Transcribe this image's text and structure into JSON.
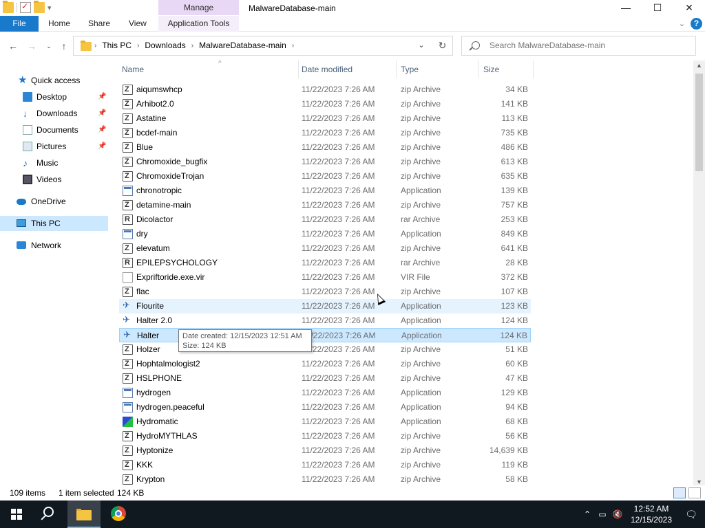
{
  "window": {
    "title": "MalwareDatabase-main",
    "context_tab": "Manage",
    "controls": {
      "minimize": "—",
      "maximize": "☐",
      "close": "✕"
    }
  },
  "ribbon": {
    "tabs": [
      "File",
      "Home",
      "Share",
      "View",
      "Application Tools"
    ]
  },
  "address": {
    "crumbs": [
      "This PC",
      "Downloads",
      "MalwareDatabase-main"
    ],
    "search_placeholder": "Search MalwareDatabase-main"
  },
  "nav": {
    "quick_access": "Quick access",
    "items": [
      {
        "label": "Desktop",
        "icon": "desktop-icon",
        "pinned": true
      },
      {
        "label": "Downloads",
        "icon": "downloads-icon",
        "pinned": true
      },
      {
        "label": "Documents",
        "icon": "documents-icon",
        "pinned": true
      },
      {
        "label": "Pictures",
        "icon": "pictures-icon",
        "pinned": true
      },
      {
        "label": "Music",
        "icon": "music-icon",
        "pinned": false
      },
      {
        "label": "Videos",
        "icon": "videos-icon",
        "pinned": false
      }
    ],
    "onedrive": "OneDrive",
    "thispc": "This PC",
    "network": "Network"
  },
  "columns": {
    "name": "Name",
    "date": "Date modified",
    "type": "Type",
    "size": "Size"
  },
  "files": [
    {
      "name": "aiqumswhcp",
      "date": "11/22/2023 7:26 AM",
      "type": "zip Archive",
      "size": "34 KB",
      "icon": "zip"
    },
    {
      "name": "Arhibot2.0",
      "date": "11/22/2023 7:26 AM",
      "type": "zip Archive",
      "size": "141 KB",
      "icon": "zip"
    },
    {
      "name": "Astatine",
      "date": "11/22/2023 7:26 AM",
      "type": "zip Archive",
      "size": "113 KB",
      "icon": "zip"
    },
    {
      "name": "bcdef-main",
      "date": "11/22/2023 7:26 AM",
      "type": "zip Archive",
      "size": "735 KB",
      "icon": "zip"
    },
    {
      "name": "Blue",
      "date": "11/22/2023 7:26 AM",
      "type": "zip Archive",
      "size": "486 KB",
      "icon": "zip"
    },
    {
      "name": "Chromoxide_bugfix",
      "date": "11/22/2023 7:26 AM",
      "type": "zip Archive",
      "size": "613 KB",
      "icon": "zip"
    },
    {
      "name": "ChromoxideTrojan",
      "date": "11/22/2023 7:26 AM",
      "type": "zip Archive",
      "size": "635 KB",
      "icon": "zip"
    },
    {
      "name": "chronotropic",
      "date": "11/22/2023 7:26 AM",
      "type": "Application",
      "size": "139 KB",
      "icon": "app"
    },
    {
      "name": "detamine-main",
      "date": "11/22/2023 7:26 AM",
      "type": "zip Archive",
      "size": "757 KB",
      "icon": "zip"
    },
    {
      "name": "Dicolactor",
      "date": "11/22/2023 7:26 AM",
      "type": "rar Archive",
      "size": "253 KB",
      "icon": "rar"
    },
    {
      "name": "dry",
      "date": "11/22/2023 7:26 AM",
      "type": "Application",
      "size": "849 KB",
      "icon": "app"
    },
    {
      "name": "elevatum",
      "date": "11/22/2023 7:26 AM",
      "type": "zip Archive",
      "size": "641 KB",
      "icon": "zip"
    },
    {
      "name": "EPILEPSYCHOLOGY",
      "date": "11/22/2023 7:26 AM",
      "type": "rar Archive",
      "size": "28 KB",
      "icon": "rar"
    },
    {
      "name": "Expriftoride.exe.vir",
      "date": "11/22/2023 7:26 AM",
      "type": "VIR File",
      "size": "372 KB",
      "icon": "vir"
    },
    {
      "name": "flac",
      "date": "11/22/2023 7:26 AM",
      "type": "zip Archive",
      "size": "107 KB",
      "icon": "zip"
    },
    {
      "name": "Flourite",
      "date": "11/22/2023 7:26 AM",
      "type": "Application",
      "size": "123 KB",
      "icon": "tool",
      "state": "hover"
    },
    {
      "name": "Halter 2.0",
      "date": "11/22/2023 7:26 AM",
      "type": "Application",
      "size": "124 KB",
      "icon": "tool"
    },
    {
      "name": "Halter",
      "date": "11/22/2023 7:26 AM",
      "type": "Application",
      "size": "124 KB",
      "icon": "tool",
      "state": "selected"
    },
    {
      "name": "Holzer",
      "date": "11/22/2023 7:26 AM",
      "type": "zip Archive",
      "size": "51 KB",
      "icon": "zip"
    },
    {
      "name": "Hophtalmologist2",
      "date": "11/22/2023 7:26 AM",
      "type": "zip Archive",
      "size": "60 KB",
      "icon": "zip"
    },
    {
      "name": "HSLPHONE",
      "date": "11/22/2023 7:26 AM",
      "type": "zip Archive",
      "size": "47 KB",
      "icon": "zip"
    },
    {
      "name": "hydrogen",
      "date": "11/22/2023 7:26 AM",
      "type": "Application",
      "size": "129 KB",
      "icon": "app"
    },
    {
      "name": "hydrogen.peaceful",
      "date": "11/22/2023 7:26 AM",
      "type": "Application",
      "size": "94 KB",
      "icon": "app"
    },
    {
      "name": "Hydromatic",
      "date": "11/22/2023 7:26 AM",
      "type": "Application",
      "size": "68 KB",
      "icon": "hydro"
    },
    {
      "name": "HydroMYTHLAS",
      "date": "11/22/2023 7:26 AM",
      "type": "zip Archive",
      "size": "56 KB",
      "icon": "zip"
    },
    {
      "name": "Hyptonize",
      "date": "11/22/2023 7:26 AM",
      "type": "zip Archive",
      "size": "14,639 KB",
      "icon": "zip"
    },
    {
      "name": "KKK",
      "date": "11/22/2023 7:26 AM",
      "type": "zip Archive",
      "size": "119 KB",
      "icon": "zip"
    },
    {
      "name": "Krypton",
      "date": "11/22/2023 7:26 AM",
      "type": "zip Archive",
      "size": "58 KB",
      "icon": "zip"
    }
  ],
  "tooltip": {
    "line1": "Date created: 12/15/2023 12:51 AM",
    "line2": "Size: 124 KB"
  },
  "status": {
    "count": "109 items",
    "selected": "1 item selected",
    "size": "124 KB"
  },
  "taskbar": {
    "time": "12:52 AM",
    "date": "12/15/2023"
  }
}
